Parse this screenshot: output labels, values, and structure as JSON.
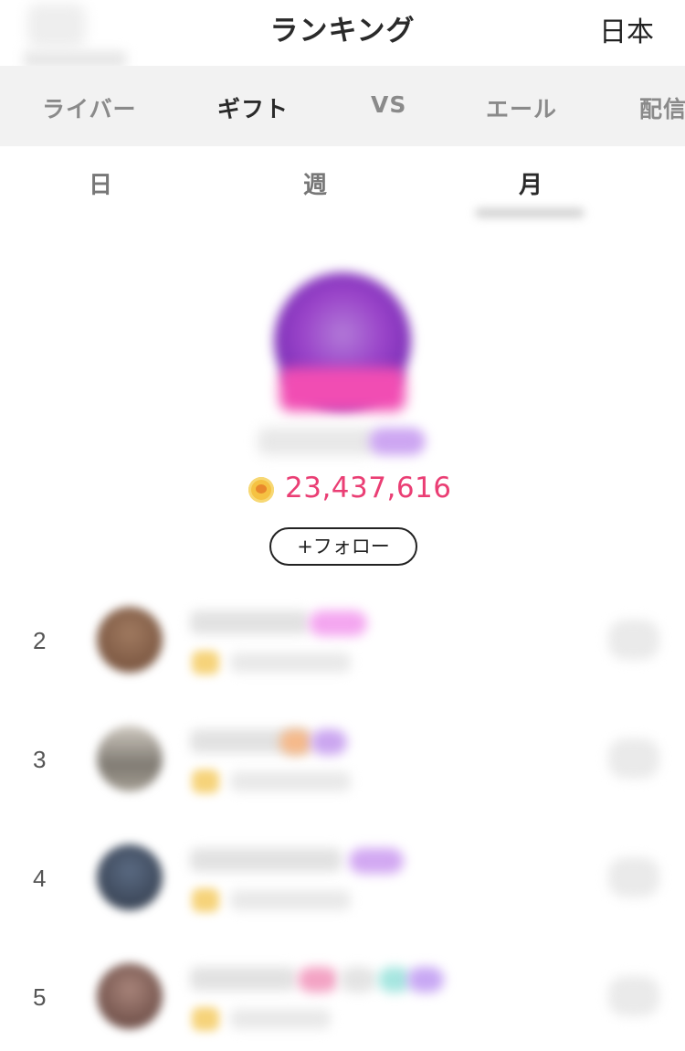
{
  "header": {
    "title": "ランキング",
    "region": "日本"
  },
  "category_tabs": [
    {
      "label": "ライバー",
      "active": false
    },
    {
      "label": "ギフト",
      "active": true
    },
    {
      "label": "VS",
      "active": false
    },
    {
      "label": "エール",
      "active": false
    },
    {
      "label": "配信",
      "active": false
    }
  ],
  "period_tabs": [
    {
      "label": "日",
      "active": false
    },
    {
      "label": "週",
      "active": false
    },
    {
      "label": "月",
      "active": true
    }
  ],
  "top_rank": {
    "points": "23,437,616",
    "follow_label": "+フォロー",
    "coin_icon": "coin-icon"
  },
  "ranking_rows": [
    {
      "rank": "2"
    },
    {
      "rank": "3"
    },
    {
      "rank": "4"
    },
    {
      "rank": "5"
    }
  ],
  "colors": {
    "points": "#ea3e74",
    "tab_bar_bg": "#f2f2f2",
    "active_text": "#2a2a2a",
    "inactive_text": "#8a8a8a"
  }
}
